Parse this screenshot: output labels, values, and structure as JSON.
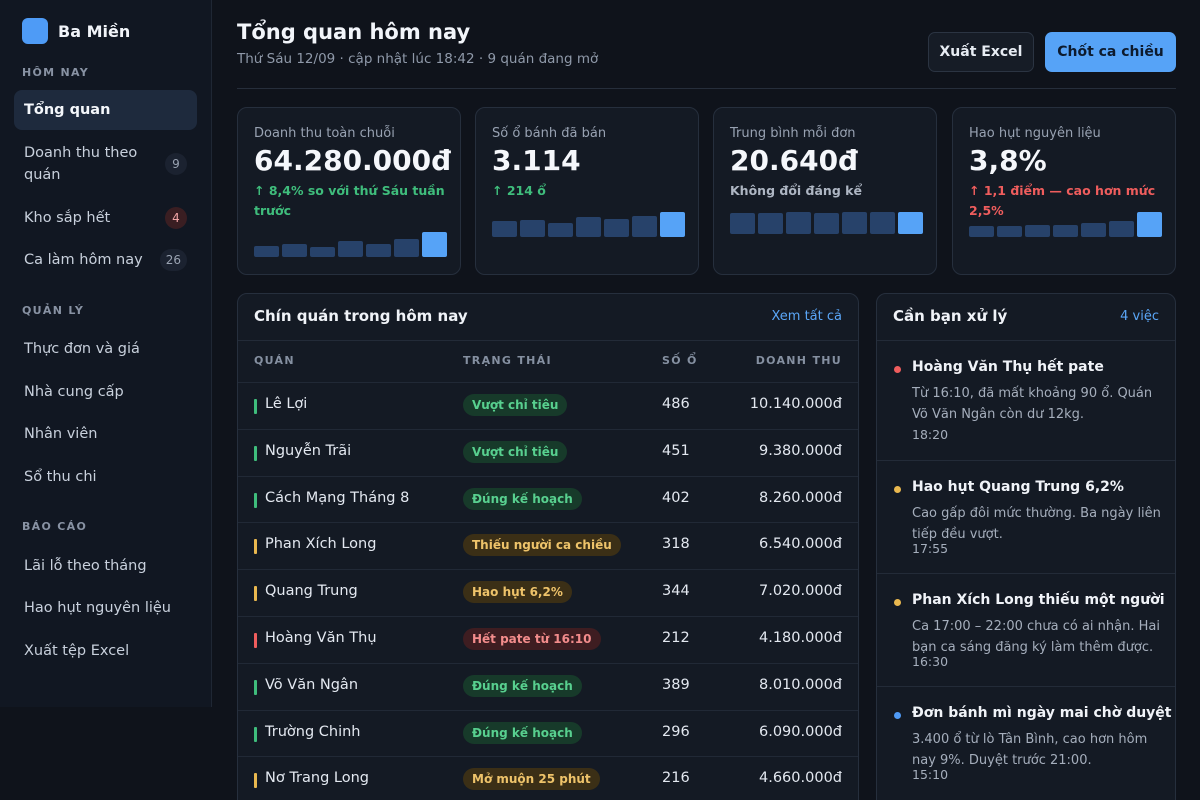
{
  "brand": {
    "name": "Ba Miền"
  },
  "sidebar": {
    "sections": [
      {
        "label": "HÔM NAY",
        "items": [
          {
            "label": "Tổng quan",
            "active": true
          },
          {
            "label": "Doanh thu theo quán",
            "badge": "9"
          },
          {
            "label": "Kho sắp hết",
            "badge": "4"
          },
          {
            "label": "Ca làm hôm nay",
            "badge": "26"
          }
        ]
      },
      {
        "label": "QUẢN LÝ",
        "items": [
          {
            "label": "Thực đơn và giá"
          },
          {
            "label": "Nhà cung cấp"
          },
          {
            "label": "Nhân viên"
          },
          {
            "label": "Sổ thu chi"
          }
        ]
      },
      {
        "label": "BÁO CÁO",
        "items": [
          {
            "label": "Lãi lỗ theo tháng"
          },
          {
            "label": "Hao hụt nguyên liệu"
          },
          {
            "label": "Xuất tệp Excel"
          }
        ]
      }
    ]
  },
  "header": {
    "title": "Tổng quan hôm nay",
    "subtitle": "Thứ Sáu 12/09 · cập nhật lúc 18:42 · 9 quán đang mở",
    "export_label": "Xuất Excel",
    "close_shift_label": "Chốt ca chiều"
  },
  "kpis": [
    {
      "label": "Doanh thu toàn chuỗi",
      "value": "64.280.000đ",
      "delta": "↑ 8,4% so với thứ Sáu tuần trước",
      "tone": "up",
      "spark": [
        0.42,
        0.52,
        0.38,
        0.62,
        0.5,
        0.7,
        1.0
      ]
    },
    {
      "label": "Số ổ bánh đã bán",
      "value": "3.114",
      "delta": "↑ 214 ổ",
      "tone": "up",
      "spark": [
        0.62,
        0.66,
        0.58,
        0.8,
        0.7,
        0.85,
        1.0
      ]
    },
    {
      "label": "Trung bình mỗi đơn",
      "value": "20.640đ",
      "delta": "Không đổi đáng kể",
      "tone": "flat",
      "spark": [
        0.85,
        0.82,
        0.88,
        0.84,
        0.86,
        0.87,
        0.86
      ]
    },
    {
      "label": "Hao hụt nguyên liệu",
      "value": "3,8%",
      "delta": "↑ 1,1 điểm — cao hơn mức 2,5%",
      "tone": "bad",
      "spark": [
        0.42,
        0.44,
        0.48,
        0.46,
        0.55,
        0.62,
        1.0
      ]
    }
  ],
  "stores": {
    "title": "Chín quán trong hôm nay",
    "link": "Xem tất cả",
    "columns": [
      "QUÁN",
      "TRẠNG THÁI",
      "SỐ Ổ",
      "DOANH THU"
    ],
    "rows": [
      {
        "name": "Lê Lợi",
        "status": "Vượt chỉ tiêu",
        "tone": "green",
        "qty": "486",
        "revenue": "10.140.000đ"
      },
      {
        "name": "Nguyễn Trãi",
        "status": "Vượt chỉ tiêu",
        "tone": "green",
        "qty": "451",
        "revenue": "9.380.000đ"
      },
      {
        "name": "Cách Mạng Tháng 8",
        "status": "Đúng kế hoạch",
        "tone": "green",
        "qty": "402",
        "revenue": "8.260.000đ"
      },
      {
        "name": "Phan Xích Long",
        "status": "Thiếu người ca chiều",
        "tone": "amber",
        "qty": "318",
        "revenue": "6.540.000đ"
      },
      {
        "name": "Quang Trung",
        "status": "Hao hụt 6,2%",
        "tone": "amber",
        "qty": "344",
        "revenue": "7.020.000đ"
      },
      {
        "name": "Hoàng Văn Thụ",
        "status": "Hết pate từ 16:10",
        "tone": "red",
        "qty": "212",
        "revenue": "4.180.000đ"
      },
      {
        "name": "Võ Văn Ngân",
        "status": "Đúng kế hoạch",
        "tone": "green",
        "qty": "389",
        "revenue": "8.010.000đ"
      },
      {
        "name": "Trường Chinh",
        "status": "Đúng kế hoạch",
        "tone": "green",
        "qty": "296",
        "revenue": "6.090.000đ"
      },
      {
        "name": "Nơ Trang Long",
        "status": "Mở muộn 25 phút",
        "tone": "amber",
        "qty": "216",
        "revenue": "4.660.000đ"
      }
    ]
  },
  "tasks": {
    "title": "Cần bạn xử lý",
    "count_label": "4 việc",
    "items": [
      {
        "title": "Hoàng Văn Thụ hết pate",
        "body": "Từ 16:10, đã mất khoảng 90 ổ. Quán Võ Văn Ngân còn dư 12kg.",
        "time": "18:20",
        "tone": "red"
      },
      {
        "title": "Hao hụt Quang Trung 6,2%",
        "body": "Cao gấp đôi mức thường. Ba ngày liên tiếp đều vượt.",
        "time": "17:55",
        "tone": "amber"
      },
      {
        "title": "Phan Xích Long thiếu một người",
        "body": "Ca 17:00 – 22:00 chưa có ai nhận. Hai bạn ca sáng đăng ký làm thêm được.",
        "time": "16:30",
        "tone": "amber"
      },
      {
        "title": "Đơn bánh mì ngày mai chờ duyệt",
        "body": "3.400 ổ từ lò Tân Bình, cao hơn hôm nay 9%. Duyệt trước 21:00.",
        "time": "15:10",
        "tone": "blue"
      }
    ]
  },
  "colors": {
    "accent": "#56a3f7",
    "green": "#3fbd7c",
    "amber": "#e9b84f",
    "red": "#ef5d5d",
    "blue": "#4f9af5"
  }
}
